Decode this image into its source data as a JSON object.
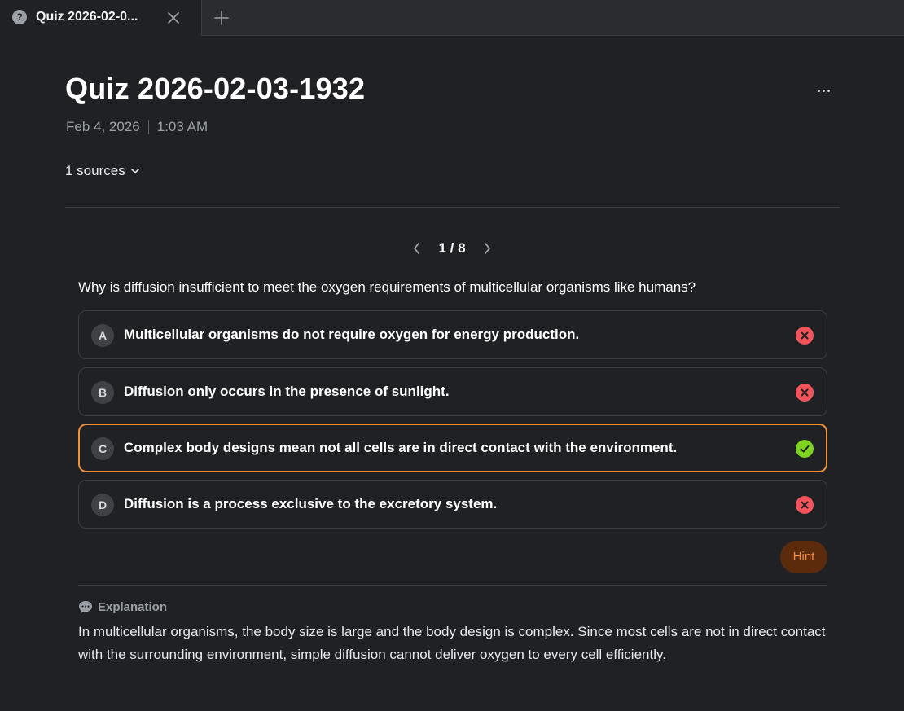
{
  "tab": {
    "title": "Quiz 2026-02-0...",
    "icon": "help-bubble-icon"
  },
  "page": {
    "title": "Quiz 2026-02-03-1932",
    "date": "Feb 4, 2026",
    "time": "1:03 AM",
    "sources_label": "1 sources"
  },
  "pager": {
    "text": "1 / 8"
  },
  "question": {
    "text": "Why is diffusion insufficient to meet the oxygen requirements of multicellular organisms like humans?"
  },
  "options": [
    {
      "letter": "A",
      "text": "Multicellular organisms do not require oxygen for energy production.",
      "status": "incorrect"
    },
    {
      "letter": "B",
      "text": "Diffusion only occurs in the presence of sunlight.",
      "status": "incorrect"
    },
    {
      "letter": "C",
      "text": "Complex body designs mean not all cells are in direct contact with the environment.",
      "status": "correct"
    },
    {
      "letter": "D",
      "text": "Diffusion is a process exclusive to the excretory system.",
      "status": "incorrect"
    }
  ],
  "hint_label": "Hint",
  "explanation": {
    "header": "Explanation",
    "text": "In multicellular organisms, the body size is large and the body design is complex. Since most cells are not in direct contact with the surrounding environment, simple diffusion cannot deliver oxygen to every cell efficiently."
  },
  "colors": {
    "selected_border": "#f0913a",
    "incorrect": "#f2545b",
    "correct": "#7ed321",
    "hint_bg": "#5c2b0c",
    "hint_text": "#f28b3c"
  }
}
